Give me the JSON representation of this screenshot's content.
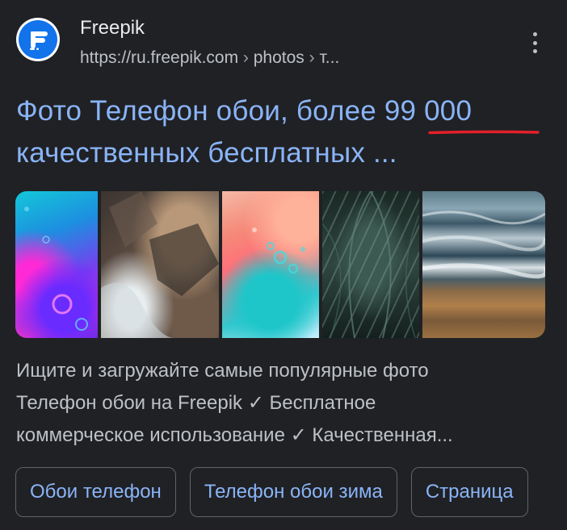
{
  "result": {
    "site_name": "Freepik",
    "url_base": "https://ru.freepik.com",
    "url_separator": " › ",
    "url_path_1": "photos",
    "url_path_2": "т...",
    "title_part_1": "Фото Телефон обои, более ",
    "title_highlight": "99 000",
    "title_line_2": "качественных бесплатных ...",
    "snippet_lines": [
      "Ищите и загружайте самые популярные фото",
      "Телефон обои на Freepik ✓ Бесплатное",
      "коммерческое использование ✓ Качественная..."
    ],
    "chips": [
      "Обои телефон",
      "Телефон обои зима",
      "Страница"
    ]
  },
  "images": [
    {
      "name": "abstract-gradient-bubbles"
    },
    {
      "name": "aerial-rocky-coast"
    },
    {
      "name": "pink-teal-liquid-drops"
    },
    {
      "name": "dark-green-leaves"
    },
    {
      "name": "aerial-beach-waves"
    }
  ],
  "colors": {
    "background": "#202124",
    "link": "#8ab4f8",
    "text": "#bdc1c6",
    "annotation_underline": "#e3202a",
    "favicon_bg": "#1273eb"
  },
  "icons": {
    "favicon": "freepik-logo-icon",
    "menu": "more-vert-icon"
  }
}
